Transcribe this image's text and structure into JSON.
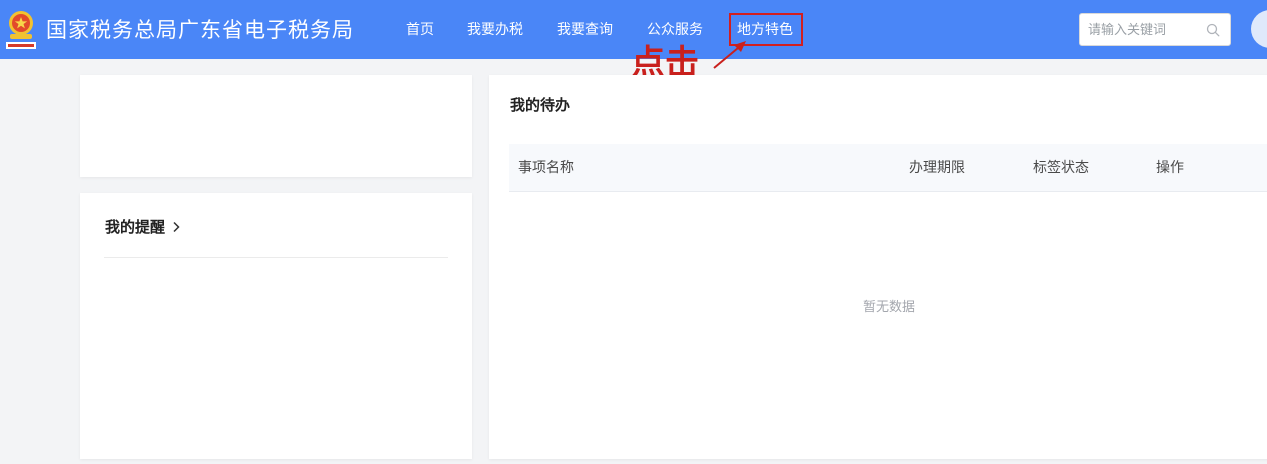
{
  "header": {
    "site_title": "国家税务总局广东省电子税务局",
    "nav": [
      {
        "label": "首页"
      },
      {
        "label": "我要办税"
      },
      {
        "label": "我要查询"
      },
      {
        "label": "公众服务"
      },
      {
        "label": "地方特色"
      }
    ],
    "search": {
      "placeholder": "请输入关键词"
    }
  },
  "annotation": {
    "text": "点击",
    "color": "#c9201d"
  },
  "reminder": {
    "title": "我的提醒"
  },
  "todo": {
    "title": "我的待办",
    "columns": [
      "事项名称",
      "办理期限",
      "标签状态",
      "操作"
    ],
    "empty_text": "暂无数据"
  },
  "colors": {
    "header_bg": "#4a86f7",
    "page_bg": "#f3f4f6"
  }
}
